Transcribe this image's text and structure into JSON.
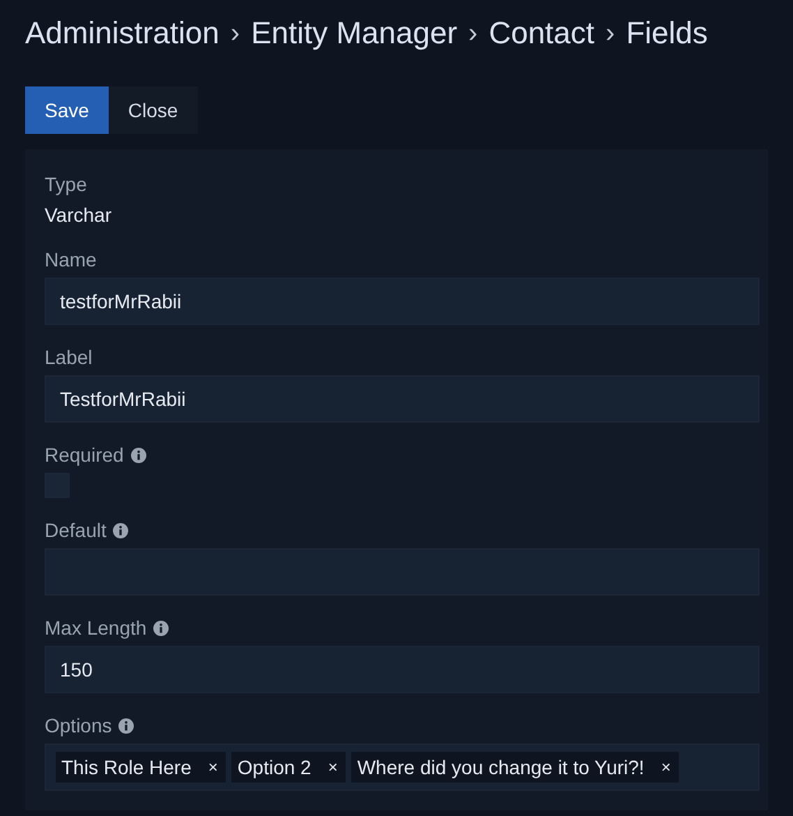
{
  "breadcrumb": [
    "Administration",
    "Entity Manager",
    "Contact",
    "Fields"
  ],
  "breadcrumb_separator": "›",
  "buttons": [
    {
      "label": "Save",
      "kind": "primary"
    },
    {
      "label": "Close",
      "kind": "default"
    }
  ],
  "fields": [
    {
      "kind": "static",
      "label": "Type",
      "info": false,
      "value": "Varchar"
    },
    {
      "kind": "text",
      "label": "Name",
      "info": false,
      "value": "testforMrRabii"
    },
    {
      "kind": "text",
      "label": "Label",
      "info": false,
      "value": "TestforMrRabii"
    },
    {
      "kind": "checkbox",
      "label": "Required",
      "info": true,
      "checked": false
    },
    {
      "kind": "text",
      "label": "Default",
      "info": true
    },
    {
      "kind": "text",
      "label": "Max Length",
      "info": true,
      "value": "150"
    },
    {
      "kind": "tags",
      "label": "Options",
      "info": true,
      "tags": [
        "This Role Here",
        "Option 2",
        "Where did you change it to Yuri?!"
      ],
      "remove": "×"
    }
  ]
}
